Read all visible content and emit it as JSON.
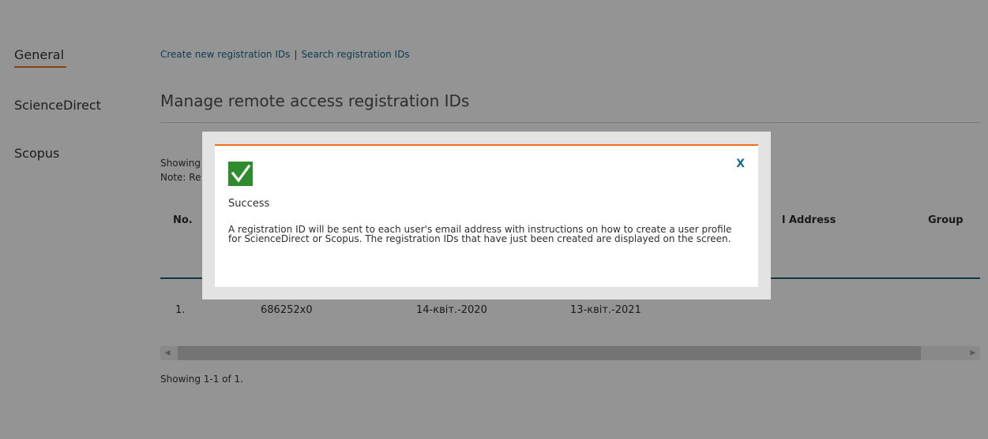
{
  "sidebar": {
    "items": [
      {
        "label": "General",
        "active": true
      },
      {
        "label": "ScienceDirect"
      },
      {
        "label": "Scopus"
      }
    ]
  },
  "links": {
    "create": "Create new registration IDs",
    "separator": "|",
    "search": "Search registration IDs"
  },
  "page": {
    "title": "Manage remote access registration IDs",
    "showing_top": "Showing 1",
    "note": "Note: Re",
    "showing_bottom": "Showing 1-1 of 1."
  },
  "table": {
    "headers": {
      "no": "No.",
      "email": "l Address",
      "group": "Group"
    },
    "rows": [
      {
        "no": "1.",
        "id": "686252x0",
        "created": "14-квіт.-2020",
        "expires": "13-квіт.-2021"
      }
    ]
  },
  "scrollbar": {
    "left_arrow": "◀",
    "right_arrow": "▶"
  },
  "modal": {
    "title": "Success",
    "message": "A registration ID will be sent to each user's email address with instructions on how to create a user profile for ScienceDirect or Scopus. The registration IDs that have just been created are displayed on the screen.",
    "close": "X",
    "icon": "check-icon"
  },
  "colors": {
    "accent": "#e9711c",
    "link": "#1a6a8a",
    "success": "#2e8b2e",
    "table_rule": "#1f5c70"
  }
}
